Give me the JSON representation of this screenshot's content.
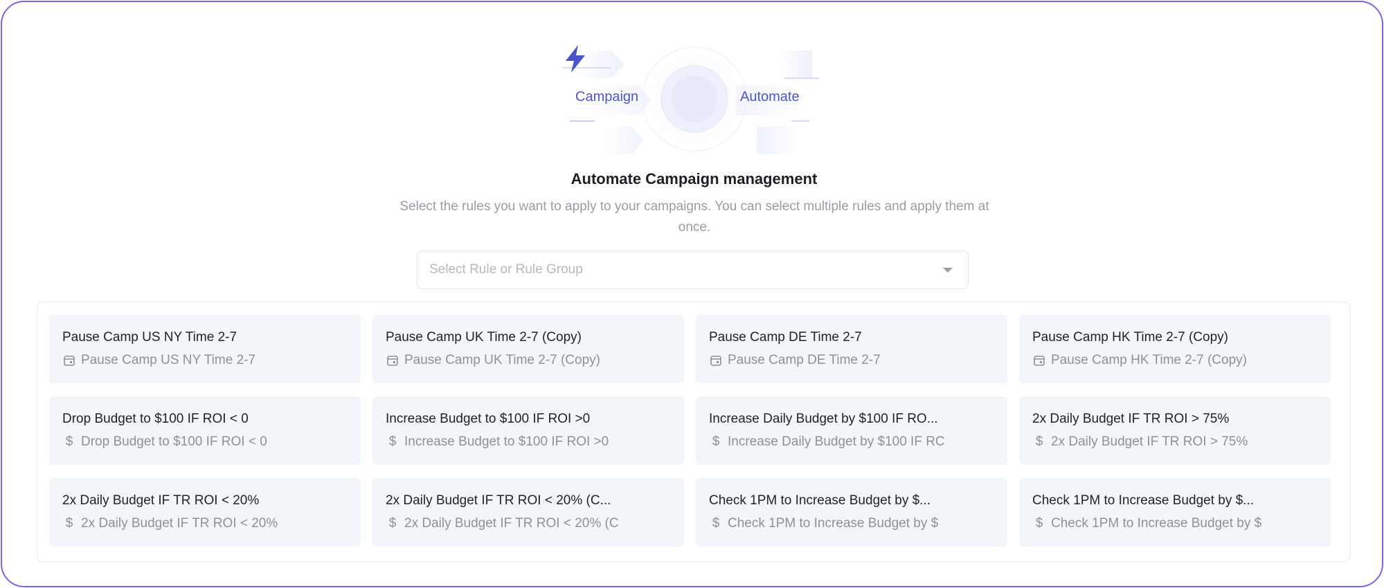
{
  "hero": {
    "left_label": "Campaign",
    "right_label": "Automate",
    "icon": "lightning-bolt-icon",
    "accent": "#4a55c9"
  },
  "header": {
    "title": "Automate Campaign management",
    "subtitle": "Select the rules you want to apply to your campaigns. You can select multiple rules and apply them at once."
  },
  "select": {
    "placeholder": "Select Rule or Rule Group",
    "icon": "caret-down-icon"
  },
  "rules": [
    {
      "title": "Pause Camp US NY Time 2-7",
      "subtitle": "Pause Camp US NY Time 2-7",
      "icon": "calendar-icon"
    },
    {
      "title": "Pause Camp UK Time 2-7 (Copy)",
      "subtitle": "Pause Camp UK Time 2-7 (Copy)",
      "icon": "calendar-icon"
    },
    {
      "title": "Pause Camp DE Time 2-7",
      "subtitle": "Pause Camp DE Time 2-7",
      "icon": "calendar-icon"
    },
    {
      "title": "Pause Camp HK Time 2-7 (Copy)",
      "subtitle": "Pause Camp HK Time 2-7 (Copy)",
      "icon": "calendar-icon"
    },
    {
      "title": "Drop Budget to $100 IF ROI < 0",
      "subtitle": "Drop Budget to $100 IF ROI < 0",
      "icon": "dollar-icon"
    },
    {
      "title": "Increase Budget to $100 IF ROI >0",
      "subtitle": "Increase Budget to $100 IF ROI >0",
      "icon": "dollar-icon"
    },
    {
      "title": "Increase Daily Budget by $100 IF RO...",
      "subtitle": "Increase Daily Budget by $100 IF RC",
      "icon": "dollar-icon"
    },
    {
      "title": "2x Daily Budget IF TR ROI > 75%",
      "subtitle": "2x Daily Budget IF TR ROI > 75%",
      "icon": "dollar-icon"
    },
    {
      "title": "2x Daily Budget IF TR ROI < 20%",
      "subtitle": "2x Daily Budget IF TR ROI < 20%",
      "icon": "dollar-icon"
    },
    {
      "title": "2x Daily Budget IF TR ROI < 20% (C...",
      "subtitle": "2x Daily Budget IF TR ROI < 20% (C",
      "icon": "dollar-icon"
    },
    {
      "title": "Check 1PM to Increase Budget by $...",
      "subtitle": "Check 1PM to Increase Budget by $",
      "icon": "dollar-icon"
    },
    {
      "title": "Check 1PM to Increase Budget by $...",
      "subtitle": "Check 1PM to Increase Budget by $",
      "icon": "dollar-icon"
    }
  ],
  "colors": {
    "frame_border": "#7a63e6",
    "card_bg": "#f2f6fa",
    "text_primary": "#1e2126",
    "text_muted": "#8e9097"
  }
}
